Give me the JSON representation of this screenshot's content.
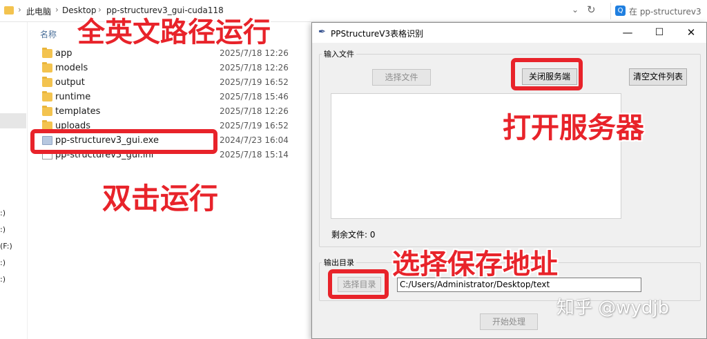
{
  "explorer": {
    "breadcrumb": [
      "此电脑",
      "Desktop",
      "pp-structurev3_gui-cuda118"
    ],
    "search_placeholder": "在 pp-structurev3",
    "nav_labels": [
      ":)",
      ":)",
      "(F:)",
      ":)",
      ":)"
    ],
    "column_name": "名称",
    "files": [
      {
        "name": "app",
        "date": "2025/7/18 12:26",
        "icon": "folder-icon"
      },
      {
        "name": "models",
        "date": "2025/7/18 12:26",
        "icon": "folder-icon"
      },
      {
        "name": "output",
        "date": "2025/7/19 16:52",
        "icon": "folder-icon"
      },
      {
        "name": "runtime",
        "date": "2025/7/18 15:46",
        "icon": "folder-icon"
      },
      {
        "name": "templates",
        "date": "2025/7/18 12:26",
        "icon": "folder-icon"
      },
      {
        "name": "uploads",
        "date": "2025/7/19 16:52",
        "icon": "folder-icon"
      },
      {
        "name": "pp-structurev3_gui.exe",
        "date": "2024/7/23 16:04",
        "icon": "exe-icon"
      },
      {
        "name": "pp-structurev3_gui.ini",
        "date": "2025/7/18 15:14",
        "icon": "settings-file-icon"
      }
    ]
  },
  "annotations": {
    "path_note": "全英文路径运行",
    "double_click_note": "双击运行",
    "open_server_note": "打开服务器",
    "save_path_note": "选择保存地址"
  },
  "dialog": {
    "title": "PPStructureV3表格识别",
    "input_group_label": "输入文件",
    "select_file_button": "选择文件",
    "close_server_button": "关闭服务端",
    "clear_list_button": "清空文件列表",
    "remaining_label": "剩余文件: 0",
    "output_group_label": "输出目录",
    "select_dir_button": "选择目录",
    "output_path": "C:/Users/Administrator/Desktop/text",
    "start_button": "开始处理",
    "minimize_symbol": "—",
    "maximize_symbol": "☐",
    "close_symbol": "✕"
  },
  "watermark": "知乎 @wydjb",
  "colors": {
    "annotation_red": "#e8232a",
    "folder_yellow": "#f3c34f",
    "dialog_bg": "#f0f0f0"
  }
}
